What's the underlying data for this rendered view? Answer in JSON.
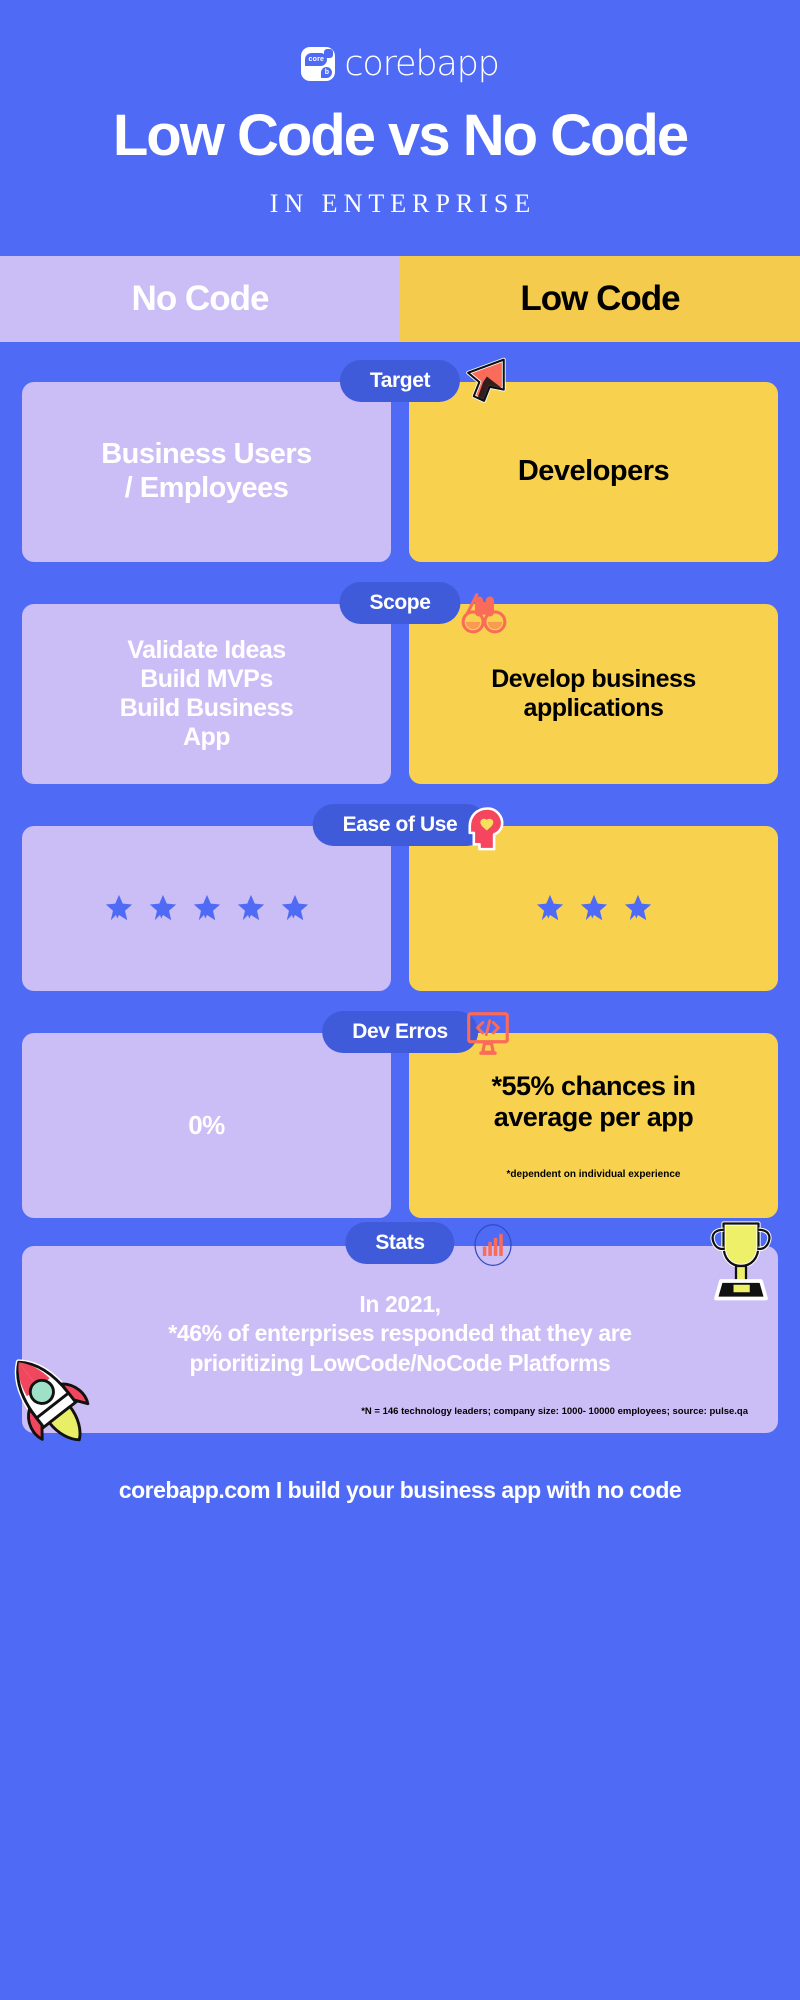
{
  "brand": {
    "logo_text": "corebapp",
    "logo_mark_core": "core",
    "logo_mark_b": "b"
  },
  "header": {
    "title": "Low Code vs No Code",
    "subtitle": "IN ENTERPRISE"
  },
  "columns": {
    "left_label": "No Code",
    "right_label": "Low Code"
  },
  "colors": {
    "background": "#4f6bf6",
    "left_card": "#cbbdf5",
    "right_card": "#f8d24f",
    "pill": "#3f5bd9",
    "accent_coral": "#fa6b5a",
    "star": "#4f6bf6",
    "text_light": "#ffffff",
    "text_dark": "#000000"
  },
  "rows": [
    {
      "pill_label": "Target",
      "icon": "cursor-arrow-icon",
      "left_text": "Business Users / Employees",
      "right_text": "Developers"
    },
    {
      "pill_label": "Scope",
      "icon": "binoculars-icon",
      "left_text": "Validate Ideas Build MVPs Build Business App",
      "right_text": "Develop business applications"
    },
    {
      "pill_label": "Ease of Use",
      "icon": "head-heart-icon",
      "left_stars": 5,
      "right_stars": 3
    },
    {
      "pill_label": "Dev Erros",
      "icon": "code-monitor-icon",
      "left_text": "0%",
      "right_text": "*55% chances in average per app",
      "right_note": "*dependent on individual experience"
    }
  ],
  "stats": {
    "pill_label": "Stats",
    "icon_chart": "bar-chart-icon",
    "icon_trophy": "trophy-icon",
    "icon_rocket": "rocket-icon",
    "line1": "In 2021,",
    "line2": "*46% of enterprises responded that they are",
    "line3": "prioritizing LowCode/NoCode Platforms",
    "note": "*N = 146 technology leaders; company size: 1000- 10000 employees; source: pulse.qa"
  },
  "footer": {
    "text": "corebapp.com I build your business app with no code"
  }
}
